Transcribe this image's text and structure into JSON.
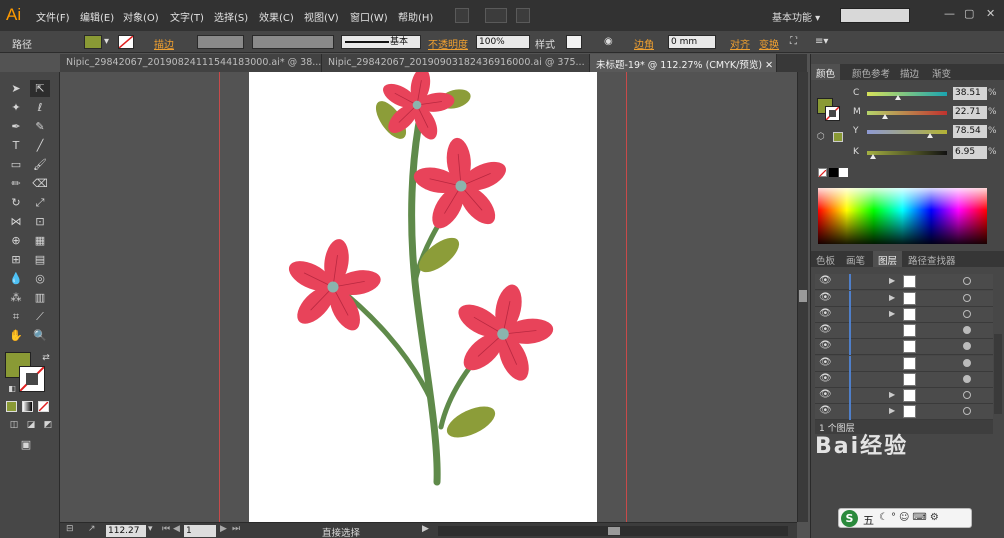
{
  "app": {
    "logo": "Ai",
    "menus": [
      "文件(F)",
      "编辑(E)",
      "对象(O)",
      "文字(T)",
      "选择(S)",
      "效果(C)",
      "视图(V)",
      "窗口(W)",
      "帮助(H)"
    ],
    "workspace_label": "基本功能",
    "search_placeholder": ""
  },
  "control_bar": {
    "object_type": "路径",
    "stroke_label": "描边",
    "stroke_style": "基本",
    "opacity_label": "不透明度",
    "opacity_value": "100%",
    "style_label": "样式",
    "corner_label": "边角",
    "corner_value": "0 mm",
    "align_label": "对齐",
    "transform_label": "变换"
  },
  "tabs": [
    {
      "label": "Nipic_29842067_20190824111544183000.ai* @ 38...",
      "active": false
    },
    {
      "label": "Nipic_29842067_20190903182436916000.ai @ 375...",
      "active": false
    },
    {
      "label": "未标题-19* @ 112.27% (CMYK/预览)",
      "active": true
    }
  ],
  "colors": {
    "fill": "#8a9a35",
    "petal": "#e8435a",
    "petal_center": "#8bb4ad",
    "stem": "#5f8a4a",
    "leaf": "#8c9d39"
  },
  "status": {
    "zoom": "112.27",
    "page": "1",
    "tool": "直接选择"
  },
  "color_panel": {
    "tabs": [
      "颜色",
      "颜色参考",
      "描边",
      "渐变"
    ],
    "channels": [
      {
        "name": "C",
        "value": "38.51",
        "unit": "%",
        "fraction": 0.3851
      },
      {
        "name": "M",
        "value": "22.71",
        "unit": "%",
        "fraction": 0.2271
      },
      {
        "name": "Y",
        "value": "78.54",
        "unit": "%",
        "fraction": 0.7854
      },
      {
        "name": "K",
        "value": "6.95",
        "unit": "%",
        "fraction": 0.0695
      }
    ]
  },
  "layers_panel": {
    "tabs": [
      "色板",
      "画笔",
      "图层",
      "路径查找器"
    ],
    "footer": "1 个图层"
  },
  "watermark": "Bai经验",
  "ime": {
    "label": "五"
  }
}
